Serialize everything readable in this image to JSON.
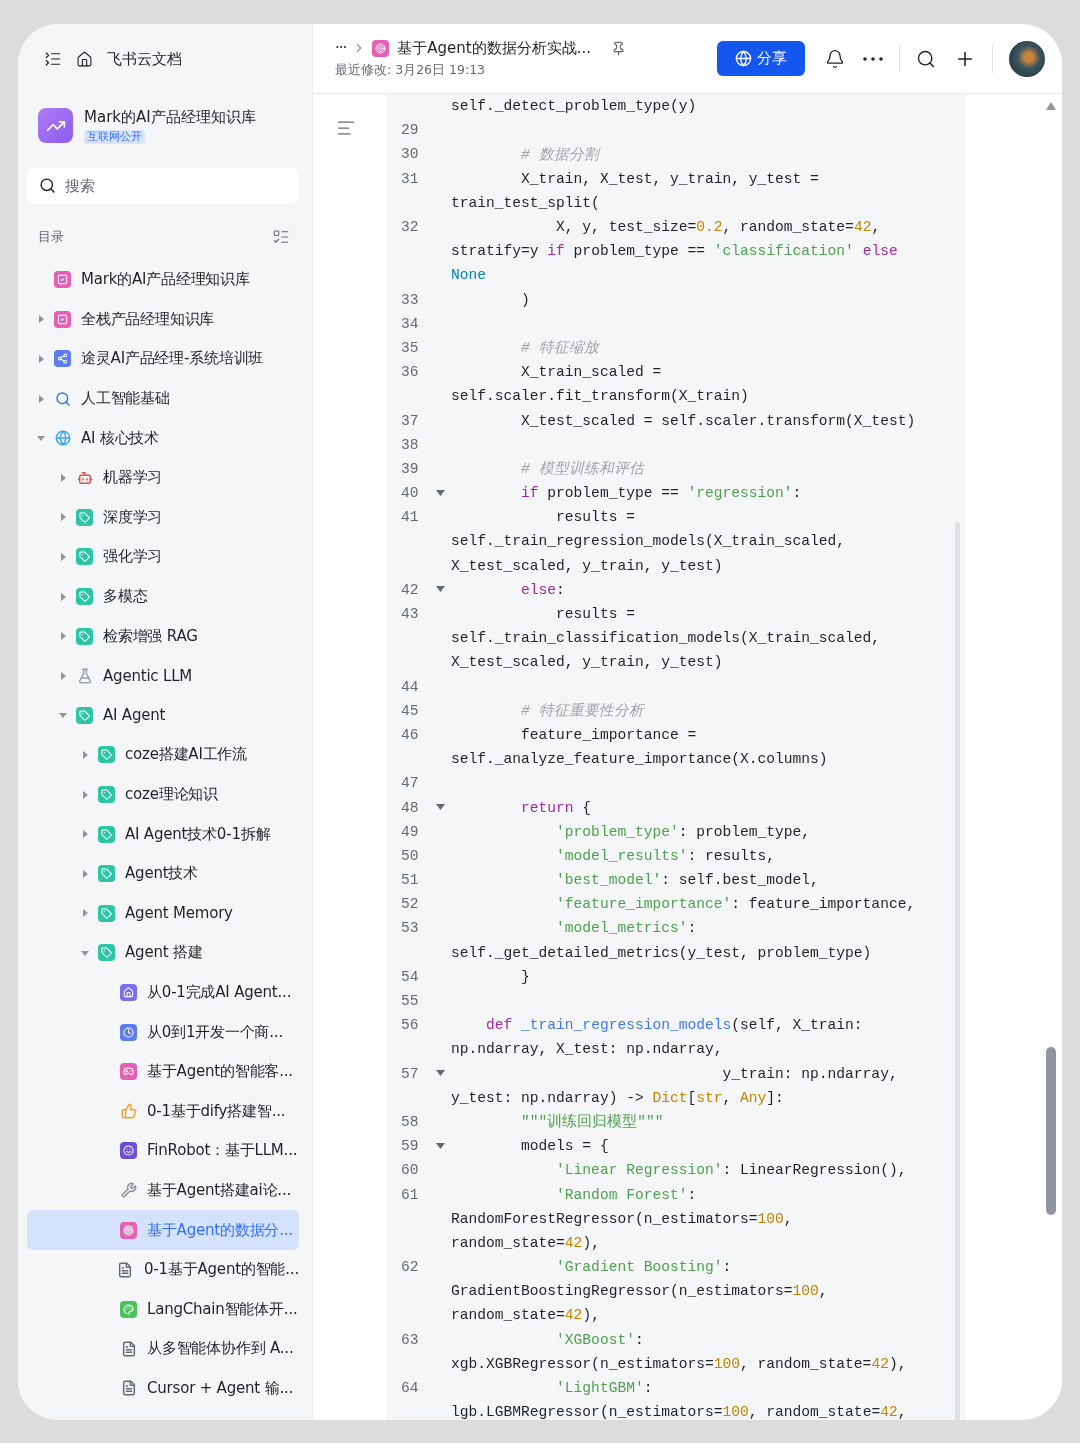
{
  "sidebar": {
    "app_title": "飞书云文档",
    "space": {
      "title": "Mark的AI产品经理知识库",
      "badge": "互联网公开"
    },
    "search": {
      "placeholder": "搜索"
    },
    "toc_label": "目录",
    "tree": [
      {
        "label": "Mark的AI产品经理知识库",
        "kind": "check",
        "color": "#e65fb4",
        "selected": false
      },
      {
        "label": "全栈产品经理知识库",
        "kind": "check",
        "color": "#e65fb4",
        "expanded": false,
        "selected": false
      },
      {
        "label": "途灵AI产品经理-系统培训班",
        "kind": "share",
        "color": "#5b7cf5",
        "expanded": false,
        "selected": false
      },
      {
        "label": "人工智能基础",
        "kind": "search",
        "color": "#3a7bd5",
        "expanded": false,
        "selected": false
      },
      {
        "label": "AI 核心技术",
        "kind": "globe",
        "color": "#3aa6e8",
        "expanded": true,
        "selected": false,
        "children": [
          {
            "label": "机器学习",
            "kind": "robot",
            "color": "#d9534f",
            "expanded": false,
            "selected": false
          },
          {
            "label": "深度学习",
            "kind": "tag",
            "color": "#2ec4a6",
            "expanded": false,
            "selected": false
          },
          {
            "label": "强化学习",
            "kind": "tag",
            "color": "#2ec4a6",
            "expanded": false,
            "selected": false
          },
          {
            "label": "多模态",
            "kind": "tag",
            "color": "#2ec4a6",
            "expanded": false,
            "selected": false
          },
          {
            "label": "检索增强 RAG",
            "kind": "tag",
            "color": "#2ec4a6",
            "expanded": false,
            "selected": false
          },
          {
            "label": "Agentic LLM",
            "kind": "flask",
            "color": "#9aa3ad",
            "expanded": false,
            "selected": false
          },
          {
            "label": "AI Agent",
            "kind": "tag",
            "color": "#2ec4a6",
            "expanded": true,
            "selected": false,
            "children": [
              {
                "label": "coze搭建AI工作流",
                "kind": "tag",
                "color": "#2ec4a6",
                "expanded": false,
                "selected": false
              },
              {
                "label": "coze理论知识",
                "kind": "tag",
                "color": "#2ec4a6",
                "expanded": false,
                "selected": false
              },
              {
                "label": "AI Agent技术0-1拆解",
                "kind": "tag",
                "color": "#2ec4a6",
                "expanded": false,
                "selected": false
              },
              {
                "label": "Agent技术",
                "kind": "tag",
                "color": "#2ec4a6",
                "expanded": false,
                "selected": false
              },
              {
                "label": "Agent Memory",
                "kind": "tag",
                "color": "#2ec4a6",
                "expanded": false,
                "selected": false
              },
              {
                "label": "Agent 搭建",
                "kind": "tag",
                "color": "#2ec4a6",
                "expanded": true,
                "selected": false,
                "children": [
                  {
                    "label": "从0-1完成AI Agent...",
                    "kind": "house",
                    "color": "#7b6cf0",
                    "selected": false
                  },
                  {
                    "label": "从0到1开发一个商...",
                    "kind": "clock",
                    "color": "#5b7cf5",
                    "selected": false
                  },
                  {
                    "label": "基于Agent的智能客...",
                    "kind": "gamepad",
                    "color": "#e65fb4",
                    "selected": false
                  },
                  {
                    "label": "0-1基于dify搭建智...",
                    "kind": "thumb",
                    "color": "#f0a030",
                    "selected": false
                  },
                  {
                    "label": "FinRobot：基于LLM...",
                    "kind": "smile",
                    "color": "#6c4fd8",
                    "selected": false
                  },
                  {
                    "label": "基于Agent搭建ai论...",
                    "kind": "tools",
                    "color": "#8a8f98",
                    "selected": false
                  },
                  {
                    "label": "基于Agent的数据分...",
                    "kind": "target",
                    "color": "#e65fb4",
                    "selected": true
                  },
                  {
                    "label": "0-1基于Agent的智能...",
                    "kind": "doc",
                    "color": "#646a73",
                    "selected": false
                  },
                  {
                    "label": "LangChain智能体开...",
                    "kind": "palette",
                    "color": "#4cc35a",
                    "selected": false
                  },
                  {
                    "label": "从多智能体协作到 A...",
                    "kind": "doc",
                    "color": "#646a73",
                    "selected": false
                  },
                  {
                    "label": "Cursor + Agent 输...",
                    "kind": "doc",
                    "color": "#646a73",
                    "selected": false
                  }
                ]
              }
            ]
          }
        ]
      }
    ]
  },
  "header": {
    "breadcrumb_more": "···",
    "title": "基于Agent的数据分析实战...",
    "modified": "最近修改: 3月26日 19:13",
    "share_button": "分享"
  },
  "code": {
    "rows": [
      {
        "tokens": [
          {
            "kind": "plain",
            "text": "self._detect_problem_type(y)"
          }
        ]
      },
      {
        "number": "29",
        "tokens": []
      },
      {
        "number": "30",
        "tokens": [
          {
            "kind": "comment",
            "text": "        # 数据分割"
          }
        ]
      },
      {
        "number": "31",
        "tokens": [
          {
            "kind": "plain",
            "text": "        X_train, X_test, y_train, y_test ="
          }
        ]
      },
      {
        "tokens": [
          {
            "kind": "plain",
            "text": "train_test_split("
          }
        ]
      },
      {
        "number": "32",
        "tokens": [
          {
            "kind": "plain",
            "text": "            X, y, test_size="
          },
          {
            "kind": "num",
            "text": "0.2"
          },
          {
            "kind": "plain",
            "text": ", random_state="
          },
          {
            "kind": "num",
            "text": "42"
          },
          {
            "kind": "plain",
            "text": ","
          }
        ]
      },
      {
        "tokens": [
          {
            "kind": "plain",
            "text": "stratify=y "
          },
          {
            "kind": "kw",
            "text": "if"
          },
          {
            "kind": "plain",
            "text": " problem_type == "
          },
          {
            "kind": "str",
            "text": "'classification'"
          },
          {
            "kind": "kw",
            "text": " else"
          }
        ]
      },
      {
        "tokens": [
          {
            "kind": "const",
            "text": "None"
          }
        ]
      },
      {
        "number": "33",
        "tokens": [
          {
            "kind": "plain",
            "text": "        )"
          }
        ]
      },
      {
        "number": "34",
        "tokens": []
      },
      {
        "number": "35",
        "tokens": [
          {
            "kind": "comment",
            "text": "        # 特征缩放"
          }
        ]
      },
      {
        "number": "36",
        "tokens": [
          {
            "kind": "plain",
            "text": "        X_train_scaled ="
          }
        ]
      },
      {
        "tokens": [
          {
            "kind": "plain",
            "text": "self.scaler.fit_transform(X_train)"
          }
        ]
      },
      {
        "number": "37",
        "tokens": [
          {
            "kind": "plain",
            "text": "        X_test_scaled = self.scaler.transform(X_test)"
          }
        ]
      },
      {
        "number": "38",
        "tokens": []
      },
      {
        "number": "39",
        "tokens": [
          {
            "kind": "comment",
            "text": "        # 模型训练和评估"
          }
        ]
      },
      {
        "number": "40",
        "fold": true,
        "tokens": [
          {
            "kind": "kw",
            "text": "        if"
          },
          {
            "kind": "plain",
            "text": " problem_type == "
          },
          {
            "kind": "str",
            "text": "'regression'"
          },
          {
            "kind": "plain",
            "text": ":"
          }
        ]
      },
      {
        "number": "41",
        "tokens": [
          {
            "kind": "plain",
            "text": "            results ="
          }
        ]
      },
      {
        "tokens": [
          {
            "kind": "plain",
            "text": "self._train_regression_models(X_train_scaled,"
          }
        ]
      },
      {
        "tokens": [
          {
            "kind": "plain",
            "text": "X_test_scaled, y_train, y_test)"
          }
        ]
      },
      {
        "number": "42",
        "fold": true,
        "tokens": [
          {
            "kind": "kw",
            "text": "        else"
          },
          {
            "kind": "plain",
            "text": ":"
          }
        ]
      },
      {
        "number": "43",
        "tokens": [
          {
            "kind": "plain",
            "text": "            results ="
          }
        ]
      },
      {
        "tokens": [
          {
            "kind": "plain",
            "text": "self._train_classification_models(X_train_scaled,"
          }
        ]
      },
      {
        "tokens": [
          {
            "kind": "plain",
            "text": "X_test_scaled, y_train, y_test)"
          }
        ]
      },
      {
        "number": "44",
        "tokens": []
      },
      {
        "number": "45",
        "tokens": [
          {
            "kind": "comment",
            "text": "        # 特征重要性分析"
          }
        ]
      },
      {
        "number": "46",
        "tokens": [
          {
            "kind": "plain",
            "text": "        feature_importance ="
          }
        ]
      },
      {
        "tokens": [
          {
            "kind": "plain",
            "text": "self._analyze_feature_importance(X.columns)"
          }
        ]
      },
      {
        "number": "47",
        "tokens": []
      },
      {
        "number": "48",
        "fold": true,
        "tokens": [
          {
            "kind": "kw",
            "text": "        return"
          },
          {
            "kind": "plain",
            "text": " {"
          }
        ]
      },
      {
        "number": "49",
        "tokens": [
          {
            "kind": "str",
            "text": "            'problem_type'"
          },
          {
            "kind": "plain",
            "text": ": problem_type,"
          }
        ]
      },
      {
        "number": "50",
        "tokens": [
          {
            "kind": "str",
            "text": "            'model_results'"
          },
          {
            "kind": "plain",
            "text": ": results,"
          }
        ]
      },
      {
        "number": "51",
        "tokens": [
          {
            "kind": "str",
            "text": "            'best_model'"
          },
          {
            "kind": "plain",
            "text": ": self.best_model,"
          }
        ]
      },
      {
        "number": "52",
        "tokens": [
          {
            "kind": "str",
            "text": "            'feature_importance'"
          },
          {
            "kind": "plain",
            "text": ": feature_importance,"
          }
        ]
      },
      {
        "number": "53",
        "tokens": [
          {
            "kind": "str",
            "text": "            'model_metrics'"
          },
          {
            "kind": "plain",
            "text": ":"
          }
        ]
      },
      {
        "tokens": [
          {
            "kind": "plain",
            "text": "self._get_detailed_metrics(y_test, problem_type)"
          }
        ]
      },
      {
        "number": "54",
        "tokens": [
          {
            "kind": "plain",
            "text": "        }"
          }
        ]
      },
      {
        "number": "55",
        "tokens": []
      },
      {
        "number": "56",
        "tokens": [
          {
            "kind": "kw",
            "text": "    def"
          },
          {
            "kind": "fn",
            "text": " _train_regression_models"
          },
          {
            "kind": "plain",
            "text": "(self, X_train:"
          }
        ]
      },
      {
        "tokens": [
          {
            "kind": "plain",
            "text": "np.ndarray, X_test: np.ndarray,"
          }
        ]
      },
      {
        "number": "57",
        "fold": true,
        "tokens": [
          {
            "kind": "plain",
            "text": "                               y_train: np.ndarray,"
          }
        ]
      },
      {
        "tokens": [
          {
            "kind": "plain",
            "text": "y_test: np.ndarray) -> "
          },
          {
            "kind": "type",
            "text": "Dict"
          },
          {
            "kind": "plain",
            "text": "["
          },
          {
            "kind": "type",
            "text": "str"
          },
          {
            "kind": "plain",
            "text": ", "
          },
          {
            "kind": "type",
            "text": "Any"
          },
          {
            "kind": "plain",
            "text": "]:"
          }
        ]
      },
      {
        "number": "58",
        "tokens": [
          {
            "kind": "str",
            "text": "        \"\"\"训练回归模型\"\"\""
          }
        ]
      },
      {
        "number": "59",
        "fold": true,
        "tokens": [
          {
            "kind": "plain",
            "text": "        models = {"
          }
        ]
      },
      {
        "number": "60",
        "tokens": [
          {
            "kind": "str",
            "text": "            'Linear Regression'"
          },
          {
            "kind": "plain",
            "text": ": LinearRegression(),"
          }
        ]
      },
      {
        "number": "61",
        "tokens": [
          {
            "kind": "str",
            "text": "            'Random Forest'"
          },
          {
            "kind": "plain",
            "text": ":"
          }
        ]
      },
      {
        "tokens": [
          {
            "kind": "plain",
            "text": "RandomForestRegressor(n_estimators="
          },
          {
            "kind": "num",
            "text": "100"
          },
          {
            "kind": "plain",
            "text": ","
          }
        ]
      },
      {
        "tokens": [
          {
            "kind": "plain",
            "text": "random_state="
          },
          {
            "kind": "num",
            "text": "42"
          },
          {
            "kind": "plain",
            "text": "),"
          }
        ]
      },
      {
        "number": "62",
        "tokens": [
          {
            "kind": "str",
            "text": "            'Gradient Boosting'"
          },
          {
            "kind": "plain",
            "text": ":"
          }
        ]
      },
      {
        "tokens": [
          {
            "kind": "plain",
            "text": "GradientBoostingRegressor(n_estimators="
          },
          {
            "kind": "num",
            "text": "100"
          },
          {
            "kind": "plain",
            "text": ","
          }
        ]
      },
      {
        "tokens": [
          {
            "kind": "plain",
            "text": "random_state="
          },
          {
            "kind": "num",
            "text": "42"
          },
          {
            "kind": "plain",
            "text": "),"
          }
        ]
      },
      {
        "number": "63",
        "tokens": [
          {
            "kind": "str",
            "text": "            'XGBoost'"
          },
          {
            "kind": "plain",
            "text": ":"
          }
        ]
      },
      {
        "tokens": [
          {
            "kind": "plain",
            "text": "xgb.XGBRegressor(n_estimators="
          },
          {
            "kind": "num",
            "text": "100"
          },
          {
            "kind": "plain",
            "text": ", random_state="
          },
          {
            "kind": "num",
            "text": "42"
          },
          {
            "kind": "plain",
            "text": "),"
          }
        ]
      },
      {
        "number": "64",
        "tokens": [
          {
            "kind": "str",
            "text": "            'LightGBM'"
          },
          {
            "kind": "plain",
            "text": ":"
          }
        ]
      },
      {
        "tokens": [
          {
            "kind": "plain",
            "text": "lgb.LGBMRegressor(n_estimators="
          },
          {
            "kind": "num",
            "text": "100"
          },
          {
            "kind": "plain",
            "text": ", random_state="
          },
          {
            "kind": "num",
            "text": "42"
          },
          {
            "kind": "plain",
            "text": ","
          }
        ]
      }
    ]
  }
}
